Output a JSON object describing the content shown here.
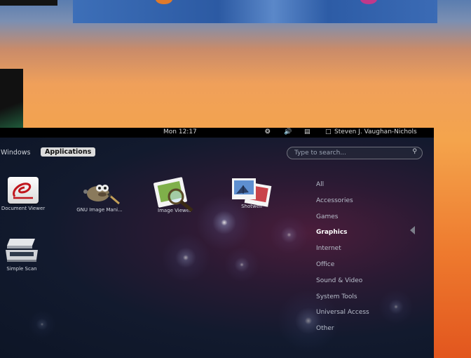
{
  "topbar": {
    "clock": "Mon 12:17",
    "user": "Steven J. Vaughan-Nichols",
    "icons": [
      "accessibility-icon",
      "volume-icon",
      "network-icon",
      "chat-icon"
    ]
  },
  "view_selector": {
    "windows_label": "Windows",
    "applications_label": "Applications",
    "active": "Applications"
  },
  "search": {
    "placeholder": "Type to search..."
  },
  "apps": [
    {
      "label": "Document Viewer",
      "icon": "document-viewer-icon"
    },
    {
      "label": "GNU Image Mani...",
      "icon": "gimp-icon"
    },
    {
      "label": "Image Viewer",
      "icon": "image-viewer-icon"
    },
    {
      "label": "Shotwell",
      "icon": "shotwell-icon"
    },
    {
      "label": "Simple Scan",
      "icon": "scanner-icon"
    }
  ],
  "categories": [
    {
      "label": "All"
    },
    {
      "label": "Accessories"
    },
    {
      "label": "Games"
    },
    {
      "label": "Graphics"
    },
    {
      "label": "Internet"
    },
    {
      "label": "Office"
    },
    {
      "label": "Sound & Video"
    },
    {
      "label": "System Tools"
    },
    {
      "label": "Universal Access"
    },
    {
      "label": "Other"
    }
  ],
  "active_category": "Graphics",
  "colors": {
    "topbar_bg": "#000000",
    "active_tab_bg": "#dcdcdc",
    "text": "#d6dae2"
  }
}
